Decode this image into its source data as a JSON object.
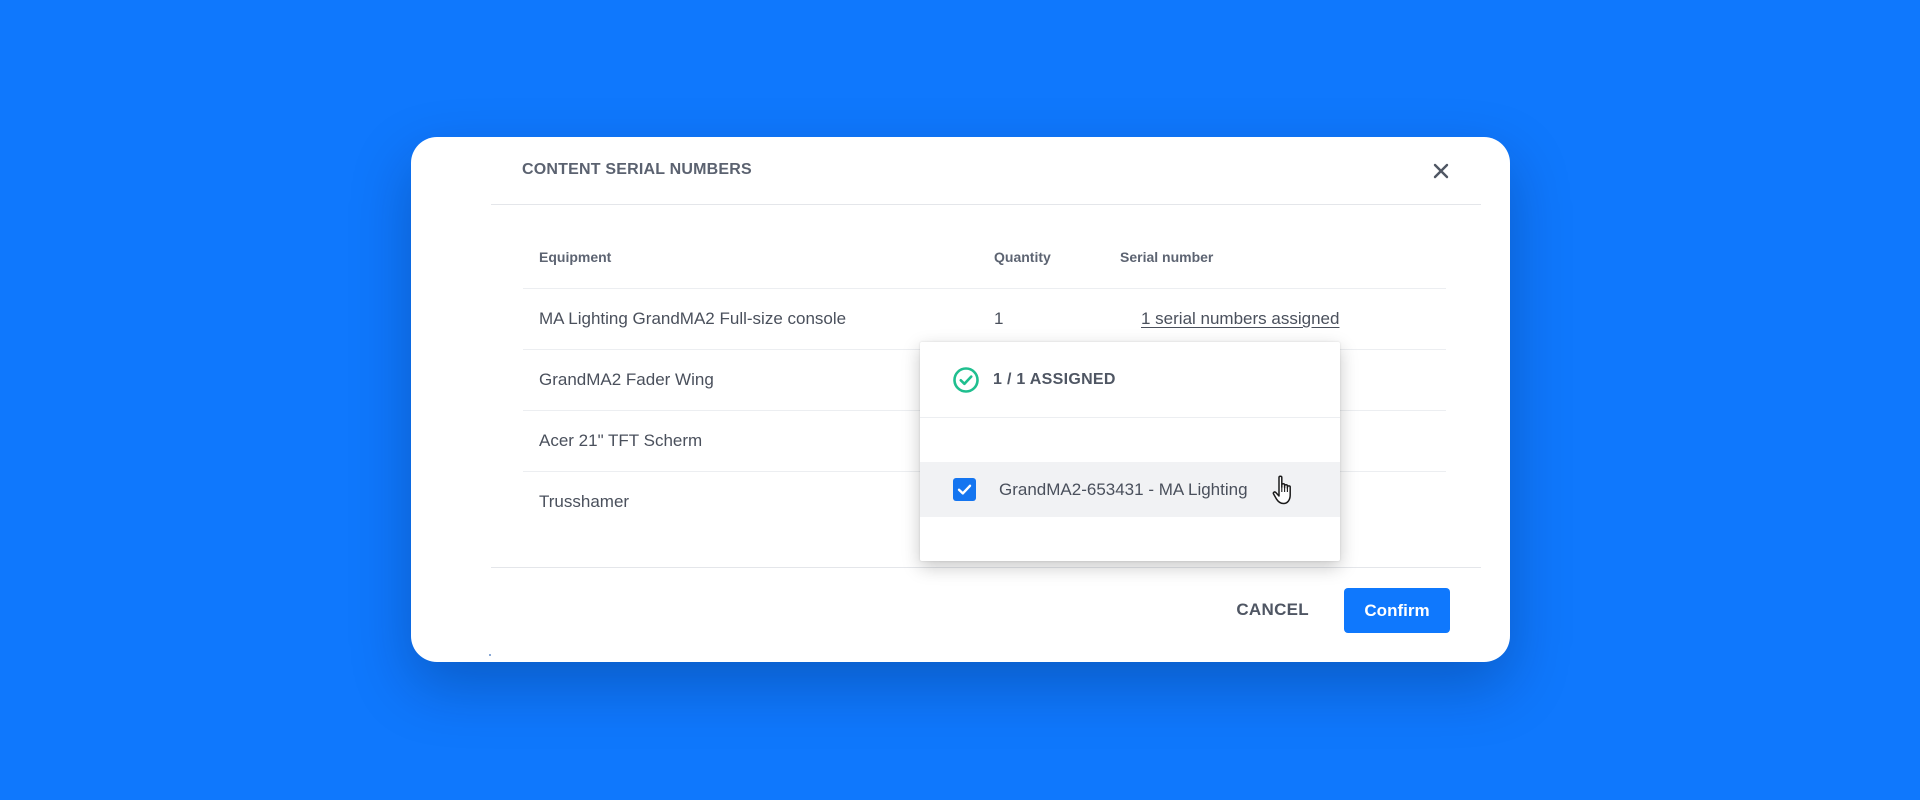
{
  "dialog": {
    "title": "CONTENT SERIAL NUMBERS",
    "close_icon": "close-icon"
  },
  "table": {
    "headers": {
      "equipment": "Equipment",
      "quantity": "Quantity",
      "serial_number": "Serial number"
    },
    "rows": [
      {
        "equipment": "MA Lighting GrandMA2 Full-size console",
        "quantity": "1",
        "serial": "1 serial numbers assigned"
      },
      {
        "equipment": "GrandMA2 Fader Wing",
        "quantity": "",
        "serial": ""
      },
      {
        "equipment": "Acer 21\" TFT Scherm",
        "quantity": "",
        "serial": ""
      },
      {
        "equipment": "Trusshamer",
        "quantity": "",
        "serial": ""
      }
    ]
  },
  "popover": {
    "status_icon": "check-circle-icon",
    "status_text": "1 / 1 ASSIGNED",
    "items": [
      {
        "label": "GrandMA2-653431 - MA Lighting",
        "checked": true
      }
    ]
  },
  "footer": {
    "cancel_label": "CANCEL",
    "confirm_label": "Confirm"
  },
  "colors": {
    "background": "#0f78fd",
    "primary": "#0f78fd",
    "success": "#1fbf8f"
  }
}
